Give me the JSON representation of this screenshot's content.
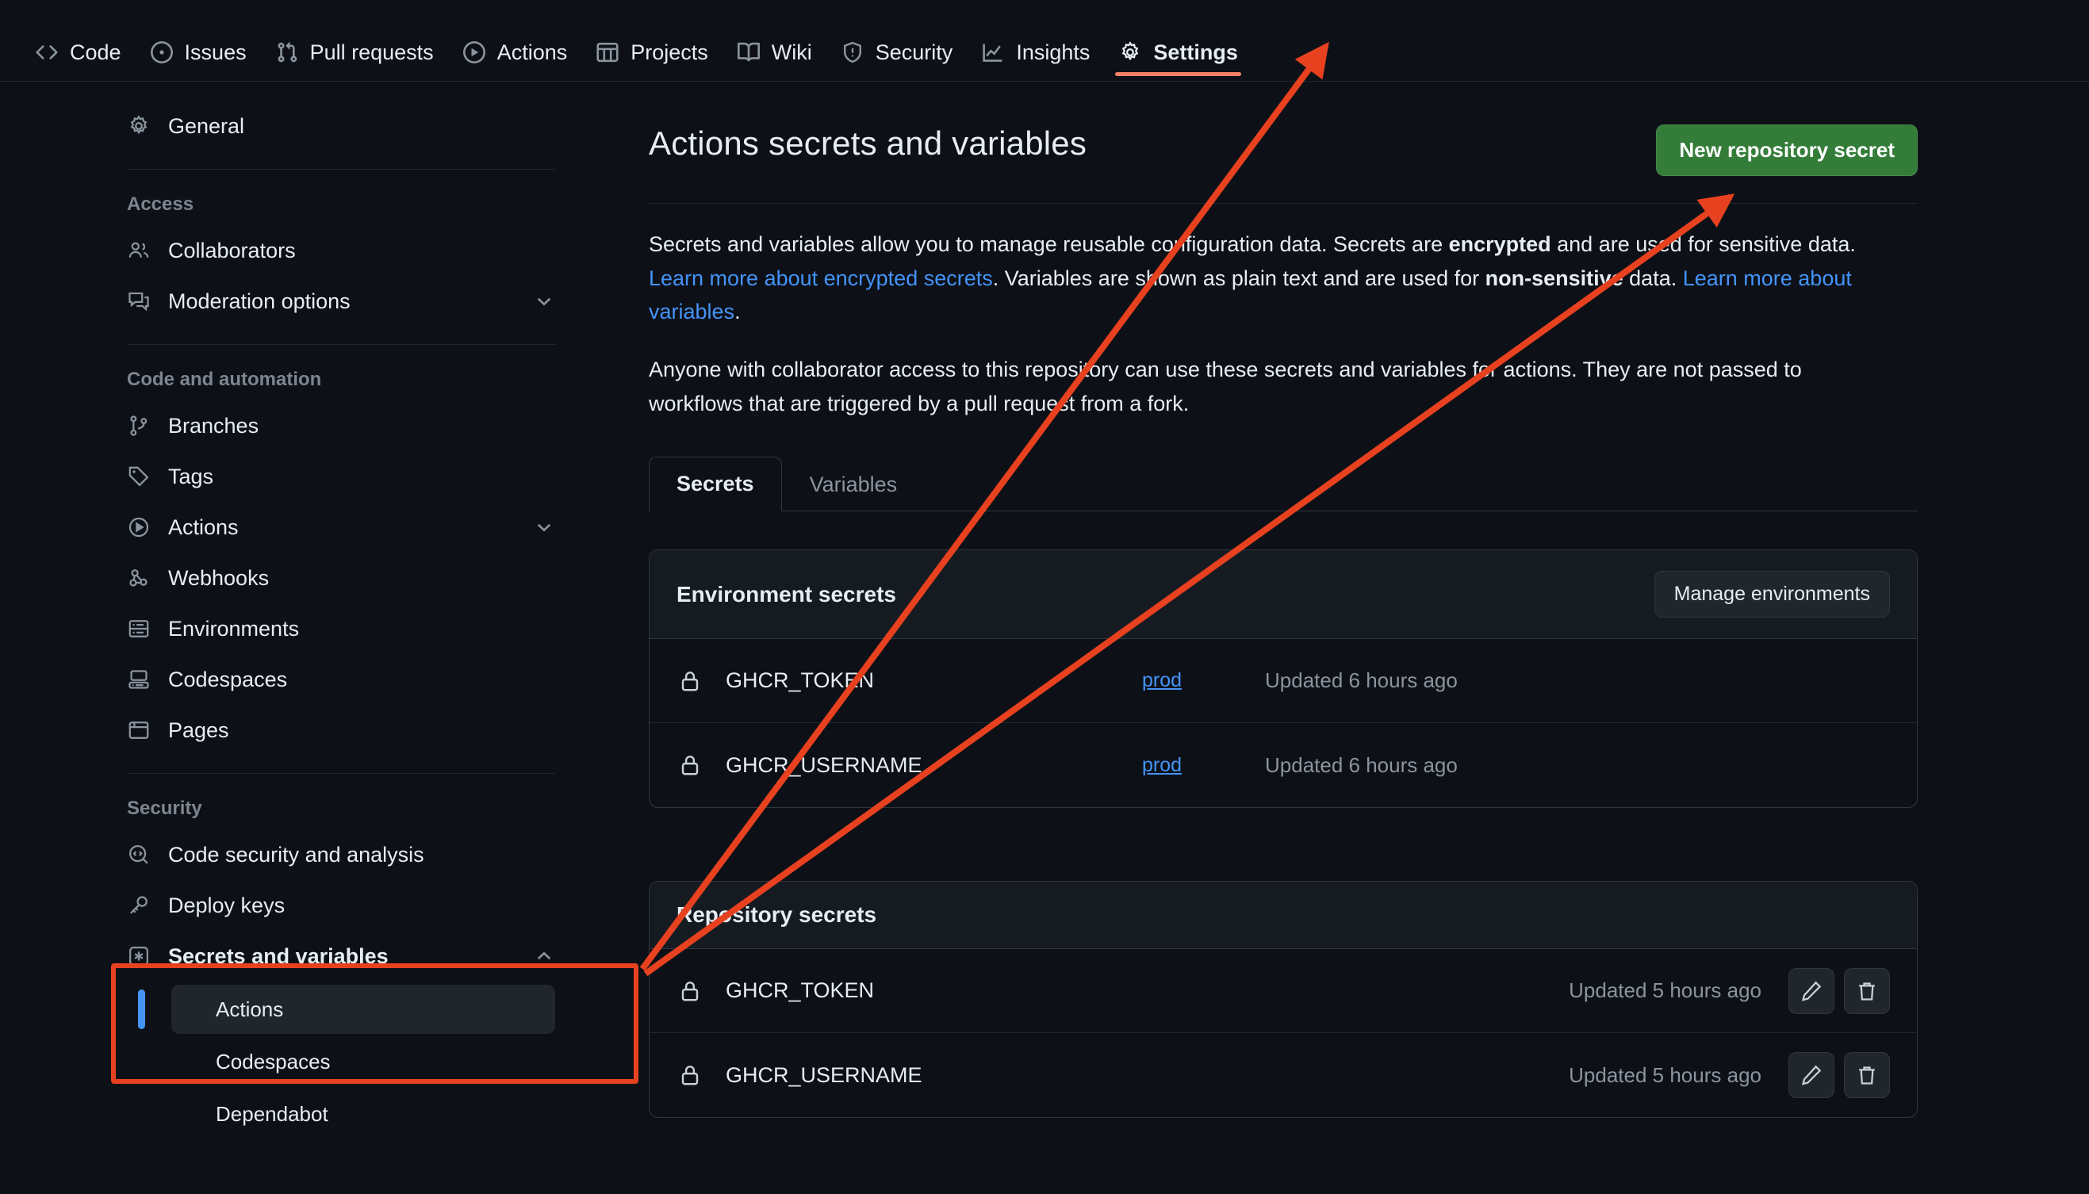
{
  "topnav": {
    "items": [
      {
        "label": "Code",
        "icon": "code-icon",
        "active": false
      },
      {
        "label": "Issues",
        "icon": "issue-opened-icon",
        "active": false
      },
      {
        "label": "Pull requests",
        "icon": "git-pull-request-icon",
        "active": false
      },
      {
        "label": "Actions",
        "icon": "play-icon",
        "active": false
      },
      {
        "label": "Projects",
        "icon": "table-icon",
        "active": false
      },
      {
        "label": "Wiki",
        "icon": "book-icon",
        "active": false
      },
      {
        "label": "Security",
        "icon": "shield-icon",
        "active": false
      },
      {
        "label": "Insights",
        "icon": "graph-icon",
        "active": false
      },
      {
        "label": "Settings",
        "icon": "gear-icon",
        "active": true
      }
    ]
  },
  "sidebar": {
    "general": {
      "label": "General",
      "icon": "gear-icon"
    },
    "sections": [
      {
        "heading": "Access",
        "items": [
          {
            "label": "Collaborators",
            "icon": "people-icon",
            "chevron": false
          },
          {
            "label": "Moderation options",
            "icon": "comment-discussion-icon",
            "chevron": "down"
          }
        ]
      },
      {
        "heading": "Code and automation",
        "items": [
          {
            "label": "Branches",
            "icon": "git-branch-icon",
            "chevron": false
          },
          {
            "label": "Tags",
            "icon": "tag-icon",
            "chevron": false
          },
          {
            "label": "Actions",
            "icon": "play-icon",
            "chevron": "down"
          },
          {
            "label": "Webhooks",
            "icon": "webhook-icon",
            "chevron": false
          },
          {
            "label": "Environments",
            "icon": "server-icon",
            "chevron": false
          },
          {
            "label": "Codespaces",
            "icon": "codespaces-icon",
            "chevron": false
          },
          {
            "label": "Pages",
            "icon": "browser-icon",
            "chevron": false
          }
        ]
      },
      {
        "heading": "Security",
        "items": [
          {
            "label": "Code security and analysis",
            "icon": "codescan-icon",
            "chevron": false
          },
          {
            "label": "Deploy keys",
            "icon": "key-icon",
            "chevron": false
          },
          {
            "label": "Secrets and variables",
            "icon": "asterisk-key-icon",
            "chevron": "up"
          }
        ]
      }
    ],
    "secrets_children": [
      {
        "label": "Actions",
        "active": true
      },
      {
        "label": "Codespaces",
        "active": false
      },
      {
        "label": "Dependabot",
        "active": false
      }
    ]
  },
  "main": {
    "title": "Actions secrets and variables",
    "new_secret_button": "New repository secret",
    "paragraph1": {
      "p1": "Secrets and variables allow you to manage reusable configuration data. Secrets are ",
      "b1": "encrypted",
      "p2": " and are used for sensitive data. ",
      "link1": "Learn more about encrypted secrets",
      "p3": ". Variables are shown as plain text and are used for ",
      "b2": "non-sensitive",
      "p4": " data. ",
      "link2": "Learn more about variables",
      "p5": "."
    },
    "paragraph2": "Anyone with collaborator access to this repository can use these secrets and variables for actions. They are not passed to workflows that are triggered by a pull request from a fork.",
    "tabs": [
      {
        "label": "Secrets",
        "active": true
      },
      {
        "label": "Variables",
        "active": false
      }
    ],
    "environment_secrets": {
      "title": "Environment secrets",
      "manage_button": "Manage environments",
      "rows": [
        {
          "name": "GHCR_TOKEN",
          "environment": "prod",
          "updated": "Updated 6 hours ago"
        },
        {
          "name": "GHCR_USERNAME",
          "environment": "prod",
          "updated": "Updated 6 hours ago"
        }
      ]
    },
    "repository_secrets": {
      "title": "Repository secrets",
      "rows": [
        {
          "name": "GHCR_TOKEN",
          "updated": "Updated 5 hours ago"
        },
        {
          "name": "GHCR_USERNAME",
          "updated": "Updated 5 hours ago"
        }
      ]
    }
  },
  "annotations": {
    "highlight_color": "#e8411f",
    "arrow_color": "#e8411f",
    "tab_underline_color": "#f78166",
    "accent_button_color": "#347d39",
    "active_item_bar_color": "#4493f8"
  }
}
